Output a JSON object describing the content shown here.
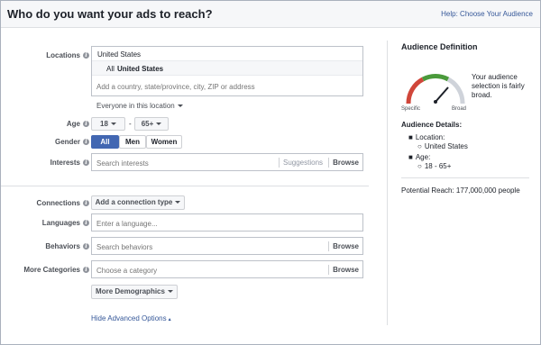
{
  "header": {
    "title": "Who do you want your ads to reach?",
    "help_link": "Help: Choose Your Audience"
  },
  "form": {
    "locations": {
      "label": "Locations",
      "country": "United States",
      "scope_prefix": "All",
      "scope_value": "United States",
      "placeholder": "Add a country, state/province, city, ZIP or address",
      "filter": "Everyone in this location"
    },
    "age": {
      "label": "Age",
      "min": "18",
      "dash": "-",
      "max": "65+"
    },
    "gender": {
      "label": "Gender",
      "options": [
        "All",
        "Men",
        "Women"
      ],
      "selected": "All"
    },
    "interests": {
      "label": "Interests",
      "placeholder": "Search interests",
      "suggestions": "Suggestions",
      "browse": "Browse"
    },
    "connections": {
      "label": "Connections",
      "button": "Add a connection type"
    },
    "languages": {
      "label": "Languages",
      "placeholder": "Enter a language..."
    },
    "behaviors": {
      "label": "Behaviors",
      "placeholder": "Search behaviors",
      "browse": "Browse"
    },
    "more_categories": {
      "label": "More Categories",
      "placeholder": "Choose a category",
      "browse": "Browse"
    },
    "more_demographics": "More Demographics",
    "hide_advanced": "Hide Advanced Options"
  },
  "sidebar": {
    "title": "Audience Definition",
    "gauge_description": "Your audience selection is fairly broad.",
    "gauge_left": "Specific",
    "gauge_right": "Broad",
    "details_title": "Audience Details:",
    "location_label": "Location:",
    "location_value": "United States",
    "age_label": "Age:",
    "age_value": "18 - 65+",
    "potential_reach": "Potential Reach: 177,000,000 people"
  },
  "colors": {
    "link": "#365899",
    "selected": "#4267b2",
    "gauge_red": "#d0463a",
    "gauge_green": "#4a9a3b"
  }
}
